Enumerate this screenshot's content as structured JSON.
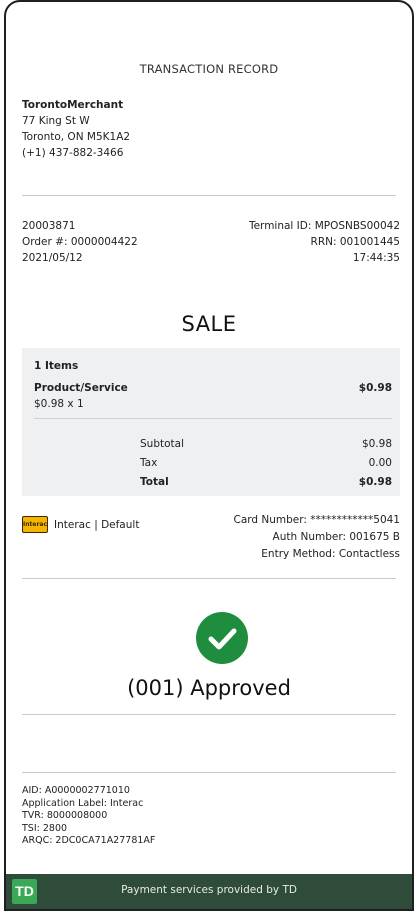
{
  "receipt": {
    "title": "TRANSACTION RECORD",
    "merchant": {
      "name": "TorontoMerchant",
      "address1": "77 King St W",
      "address2": "Toronto, ON M5K1A2",
      "phone": "(+1) 437-882-3466"
    },
    "meta_left": [
      "20003871",
      "Order #: 0000004422",
      "2021/05/12"
    ],
    "meta_right": [
      "Terminal ID: MPOSNBS00042",
      "RRN: 001001445",
      "17:44:35"
    ],
    "sale_label": "SALE",
    "items": {
      "count_label": "1 Items",
      "product_label": "Product/Service",
      "product_price": "$0.98",
      "qty_line": "$0.98 x 1",
      "subtotal_label": "Subtotal",
      "subtotal_value": "$0.98",
      "tax_label": "Tax",
      "tax_value": "0.00",
      "total_label": "Total",
      "total_value": "$0.98"
    },
    "card": {
      "brand_text": "Interac | Default",
      "icon_text": "Interac",
      "card_number": "Card Number: ************5041",
      "auth_number": "Auth Number: 001675 B",
      "entry_method": "Entry Method: Contactless"
    },
    "approved_text": "(001) Approved",
    "details": [
      "AID: A0000002771010",
      "Application Label: Interac",
      "TVR: 8000008000",
      "TSI: 2800",
      "ARQC: 2DC0CA71A27781AF"
    ],
    "footer": {
      "logo_text": "TD",
      "text": "Payment services provided by TD"
    }
  },
  "colors": {
    "footer_bg": "#2f4b3a",
    "check_green": "#1e8e3e",
    "td_green": "#3aa856",
    "interac_yellow": "#f4b400"
  }
}
